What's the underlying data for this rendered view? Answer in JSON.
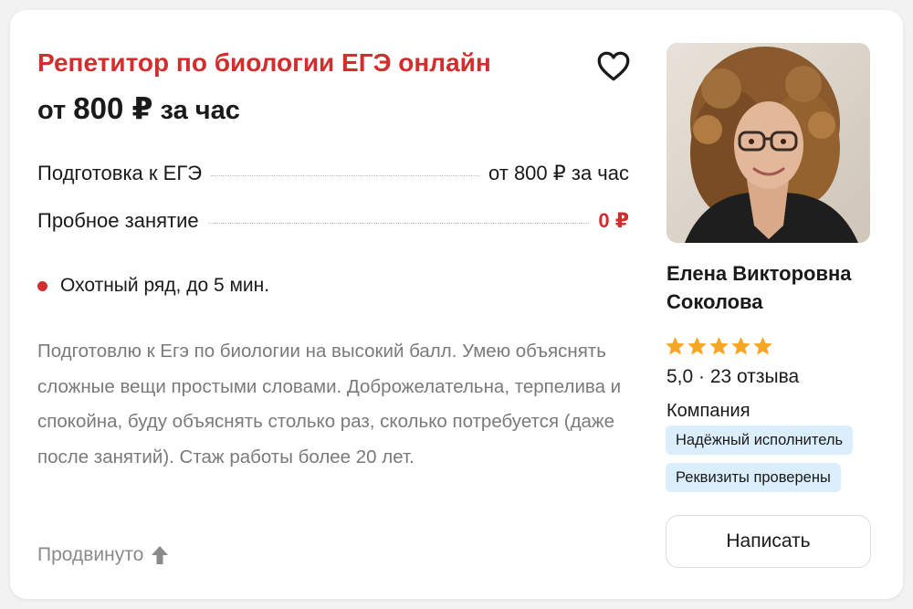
{
  "listing": {
    "title": "Репетитор по биологии ЕГЭ онлайн",
    "price_prefix": "от",
    "price_value": "800 ₽",
    "price_suffix": "за час"
  },
  "services": [
    {
      "name": "Подготовка к ЕГЭ",
      "price": "от 800 ₽ за час"
    },
    {
      "name": "Пробное занятие",
      "price": "0 ₽"
    }
  ],
  "location": {
    "metro": "Охотный ряд, до 5 мин."
  },
  "description": "Подготовлю к Егэ по биологии на высокий балл. Умею объяснять сложные вещи простыми словами. Доброжелательна, терпелива и спокойна, буду объяснять столько раз, сколько потребуется (даже после занятий). Стаж работы более 20 лет.",
  "promoted_label": "Продвинуто",
  "tutor": {
    "first_name_line": "Елена Викторовна",
    "last_name_line": "Соколова",
    "rating_text": "5,0 · 23 отзыва",
    "stars": 5,
    "type": "Компания",
    "badges": [
      "Надёжный исполнитель",
      "Реквизиты проверены"
    ]
  },
  "actions": {
    "write_label": "Написать"
  },
  "colors": {
    "accent_red": "#d22e2e",
    "star_gold": "#f5a623",
    "badge_blue": "#dbeefc"
  },
  "icons": {
    "favorite": "heart-outline-icon",
    "promoted": "arrow-up-icon",
    "metro": "red-dot-icon",
    "rating": "star-icon"
  }
}
